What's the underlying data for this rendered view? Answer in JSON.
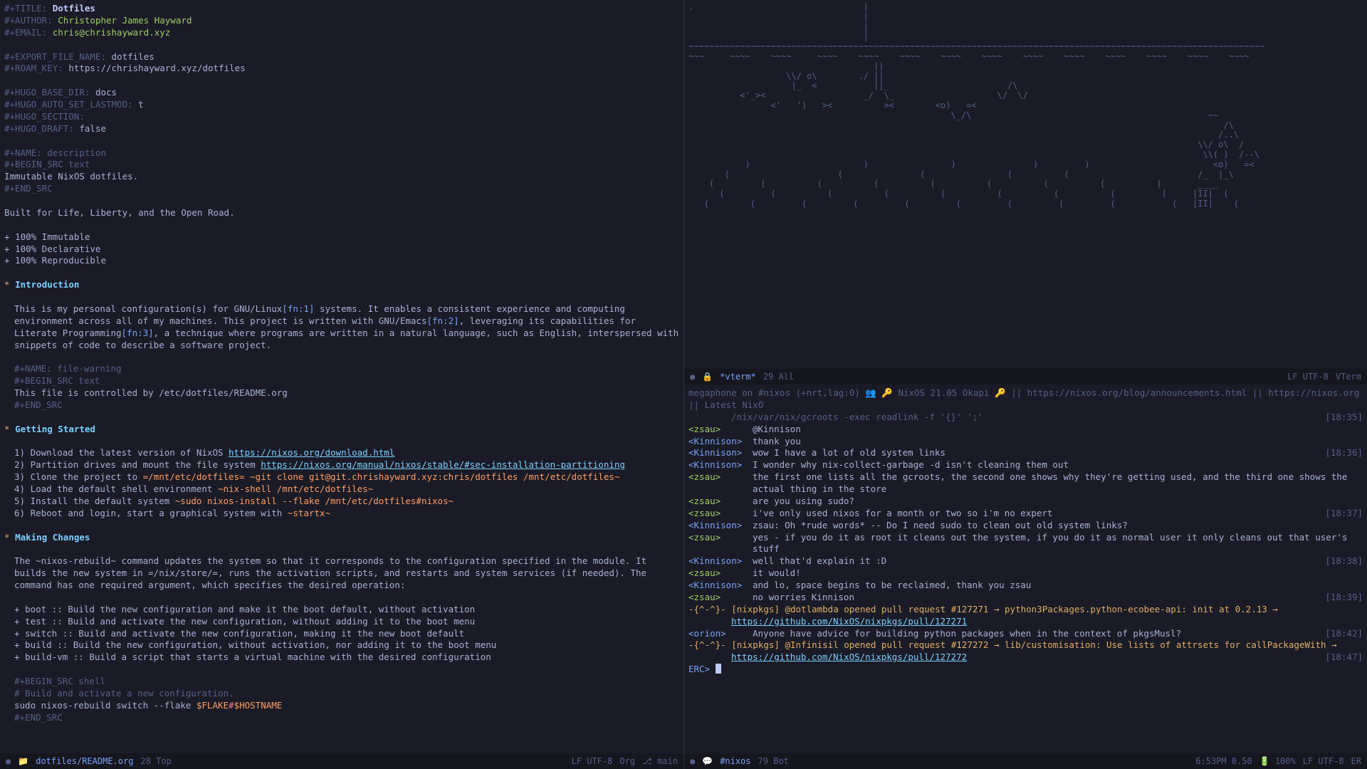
{
  "left": {
    "props": [
      {
        "k": "#+TITLE:",
        "v": "Dotfiles",
        "vcls": "hl bold"
      },
      {
        "k": "#+AUTHOR:",
        "v": "Christopher James Hayward",
        "vcls": "val"
      },
      {
        "k": "#+EMAIL:",
        "v": "chris@chrishayward.xyz",
        "vcls": "val"
      }
    ],
    "props2": [
      {
        "k": "#+EXPORT_FILE_NAME:",
        "v": "dotfiles"
      },
      {
        "k": "#+ROAM_KEY:",
        "v": "https://chrishayward.xyz/dotfiles"
      }
    ],
    "props3": [
      {
        "k": "#+HUGO_BASE_DIR:",
        "v": "docs"
      },
      {
        "k": "#+HUGO_AUTO_SET_LASTMOD:",
        "v": "t"
      },
      {
        "k": "#+HUGO_SECTION:",
        "v": ""
      },
      {
        "k": "#+HUGO_DRAFT:",
        "v": "false"
      }
    ],
    "name_desc": "#+NAME: description",
    "begin_text": "#+BEGIN_SRC text",
    "desc_body": "Immutable NixOS dotfiles.",
    "end_src": "#+END_SRC",
    "tagline": "Built for Life, Liberty, and the Open Road.",
    "bullets": [
      "+ 100% Immutable",
      "+ 100% Declarative",
      "+ 100% Reproducible"
    ],
    "h_intro": "Introduction",
    "intro_pre": "This is my personal configuration(s) for GNU/Linux",
    "fn1": "[fn:1]",
    "intro_mid1": " systems. It enables a consistent experience and computing environment across all of my machines. This project is written with GNU/Emacs",
    "fn2": "[fn:2]",
    "intro_mid2": ", leveraging its capabilities for Literate Programming",
    "fn3": "[fn:3]",
    "intro_post": ", a technique where programs are written in a natural language, such as English, interspersed with snippets of code to describe a software project.",
    "name_warn": "#+NAME: file-warning",
    "warn_body": "This file is controlled by /etc/dotfiles/README.org",
    "h_getting": "Getting Started",
    "gs": [
      {
        "n": "1) ",
        "t": "Download the latest version of NixOS ",
        "url": "https://nixos.org/download.html"
      },
      {
        "n": "2) ",
        "t": "Partition drives and mount the file system ",
        "url": "https://nixos.org/manual/nixos/stable/#sec-installation-partitioning"
      },
      {
        "n": "3) ",
        "t": "Clone the project to ",
        "code": "=/mnt/etc/dotfiles= ~git clone git@git.chrishayward.xyz:chris/dotfiles /mnt/etc/dotfiles~"
      },
      {
        "n": "4) ",
        "t": "Load the default shell environment ",
        "code": "~nix-shell /mnt/etc/dotfiles~"
      },
      {
        "n": "5) ",
        "t": "Install the default system ",
        "code": "~sudo nixos-install --flake /mnt/etc/dotfiles#nixos~"
      },
      {
        "n": "6) ",
        "t": "Reboot and login, start a graphical system with ",
        "code": "~startx~"
      }
    ],
    "h_making": "Making Changes",
    "mc_para": "The ~nixos-rebuild~ command updates the system so that it corresponds to the configuration specified in the module. It builds the new system in =/nix/store/=, runs the activation scripts, and restarts and system services (if needed). The command has one required argument, which specifies the desired operation:",
    "mc_ops": [
      "+ boot :: Build the new configuration and make it the boot default, without activation",
      "+ test :: Build and activate the new configuration, without adding it to the boot menu",
      "+ switch :: Build and activate the new configuration, making it the new boot default",
      "+ build :: Build the new configuration, without activation, nor adding it to the boot menu",
      "+ build-vm :: Build a script that starts a virtual machine with the desired configuration"
    ],
    "begin_sh": "#+BEGIN_SRC shell",
    "sh_comment": "# Build and activate a new configuration.",
    "sh_cmd_pre": "sudo nixos-rebuild switch --flake ",
    "sh_var1": "$FLAKE",
    "sh_hash": "#",
    "sh_var2": "$HOSTNAME",
    "modeline": {
      "file": "dotfiles/README.org",
      "pos": "28 Top",
      "enc": "LF UTF-8",
      "mode": "Org",
      "branch": "⎇ main"
    }
  },
  "tr": {
    "modeline": {
      "buf": "*vterm*",
      "pos": "29 All",
      "enc": "LF UTF-8",
      "mode": "VTerm"
    }
  },
  "br": {
    "topic": "megaphone on #nixos (+nrt,lag:0) 👥 🔑 NixOS 21.05 Okapi 🔑 || https://nixos.org/blog/announcements.html || https://nixos.org || Latest NixO",
    "topic2": "/nix/var/nix/gcroots -exec readlink -f '{}' ';'",
    "ts_topic": "[18:35]",
    "lines": [
      {
        "nick": "<zsau>",
        "txt": "@Kinnison"
      },
      {
        "nick": "<Kinnison>",
        "txt": "thank you"
      },
      {
        "nick": "<Kinnison>",
        "txt": "wow I have a lot of old system links",
        "ts": "[18:36]"
      },
      {
        "nick": "<Kinnison>",
        "txt": "I wonder why nix-collect-garbage -d isn't cleaning them out"
      },
      {
        "nick": "<zsau>",
        "txt": "the first one lists all the gcroots, the second one shows why they're getting used, and the third one shows the actual thing in the store"
      },
      {
        "nick": "<zsau>",
        "txt": "are you using sudo?"
      },
      {
        "nick": "<zsau>",
        "txt": "i've only used nixos for a month or two so i'm no expert",
        "ts": "[18:37]"
      },
      {
        "nick": "<Kinnison>",
        "txt": "zsau: Oh *rude words* -- Do I need sudo to clean out old system links?"
      },
      {
        "nick": "<zsau>",
        "txt": "yes - if you do it as root it cleans out the system, if you do it as normal user it only cleans out that user's stuff"
      },
      {
        "nick": "<Kinnison>",
        "txt": "well that'd explain it :D",
        "ts": "[18:38]"
      },
      {
        "nick": "<zsau>",
        "txt": "it would!"
      },
      {
        "nick": "<Kinnison>",
        "txt": "and lo, space begins to be reclaimed, thank you zsau"
      },
      {
        "nick": "<zsau>",
        "txt": "no worries Kinnison",
        "ts": "[18:39]"
      }
    ],
    "pr1": {
      "pre": "-{^-^}- [nixpkgs] @dotlambda opened pull request #127271 → python3Packages.python-ecobee-api: init at 0.2.13 → ",
      "url": "https://github.com/NixOS/nixpkgs/pull/127271"
    },
    "orion": {
      "nick": "<orion>",
      "txt": "Anyone have advice for building python packages when in the context of pkgsMusl?",
      "ts": "[18:42]"
    },
    "pr2": {
      "pre": "-{^-^}- [nixpkgs] @Infinisil opened pull request #127272 → lib/customisation: Use lists of attrsets for callPackageWith → ",
      "url": "https://github.com/NixOS/nixpkgs/pull/127272",
      "ts": "[18:47]"
    },
    "prompt": "ERC>",
    "modeline": {
      "buf": "#nixos",
      "pos": "79 Bot",
      "time": "6:53PM 0.50",
      "bat": "🔋 100%",
      "enc": "LF UTF-8",
      "mode": "ER"
    }
  },
  "ascii": ".                                 |\n                                  |\n                                  |\n                                  |\n~~~~~~~~~~~~~~~~~~~~~~~~~~~~~~~~~~~~~~~~~~~~~~~~~~~~~~~~~~~~~~~~~~~~~~~~~~~~~~~~~~~~~~~~~~~~~~~~~~~~~~~~~~~~~~~~\n~~~     ~~~~    ~~~~     ~~~~    ~~~~    ~~~~    ~~~~    ~~~~    ~~~~    ~~~~    ~~~~    ~~~~    ~~~~    ~~~~\n                                    ||\n                   \\\\/ o\\        ./ ||\n                    |_  <           ||_                       /\\\n          <'_><                   _/  \\_                    \\/  \\/\n                <'   ')   ><          ><        <o)   =<\n                                                   \\_/\\                                              ~~\n                                                                                                        /\\\n                                                                                                       /..\\\n                                                                                                   \\\\/ o\\  /\n                                                                                                    \\\\( )  /--\\\n           )                      )                )               )         )                        <o)   =<\n       (                     (               (                (          (                         /_  |_\\",
  "ascii2": "    (         (          (          (          (          (          (          (          (       ____\n      (         (          (          (          (          (          (          (         (     |II|  (\n   (        (         (         (         (         (         (         (         (           (   |II|    ("
}
